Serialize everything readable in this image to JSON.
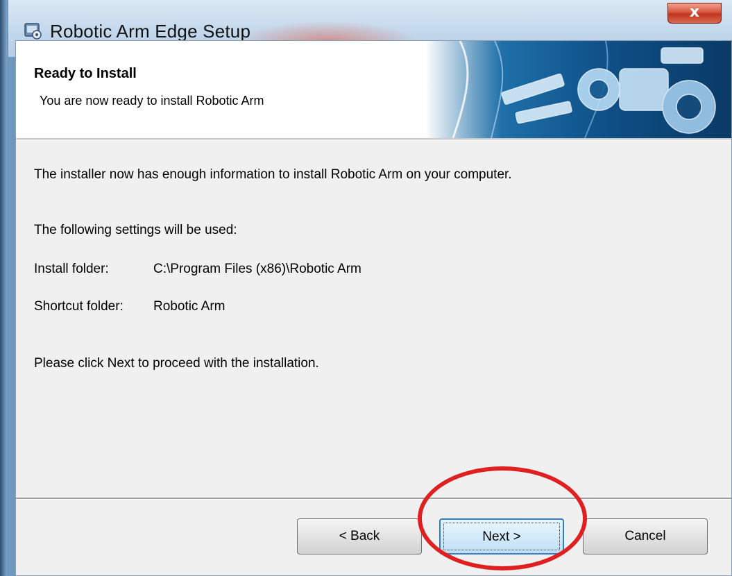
{
  "window": {
    "title": "Robotic Arm Edge Setup",
    "close_label": "x"
  },
  "header": {
    "title": "Ready to Install",
    "subtitle": "You are now ready to install Robotic Arm"
  },
  "body": {
    "info": "The installer now has enough information to install Robotic Arm on your computer.",
    "settings_intro": "The following settings will be used:",
    "install_folder_label": "Install folder:",
    "install_folder_value": "C:\\Program Files (x86)\\Robotic Arm",
    "shortcut_folder_label": "Shortcut folder:",
    "shortcut_folder_value": "Robotic Arm",
    "instruction": "Please click Next to proceed with the installation."
  },
  "buttons": {
    "back": "< Back",
    "next": "Next >",
    "cancel": "Cancel"
  },
  "colors": {
    "highlight": "#e02020",
    "close": "#c0341f",
    "default_button": "#2a7fc6"
  }
}
